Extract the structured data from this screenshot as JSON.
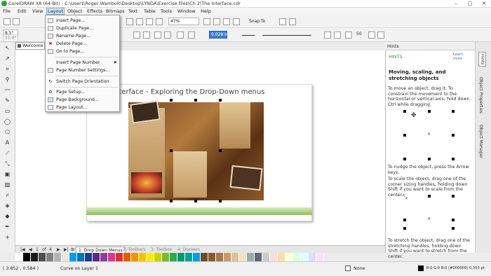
{
  "title": "CorelDRAW X8 (64-Bit) - C:\\Users\\Roger Wambolt\\Desktop\\LYNDA\\Exercise files\\Ch 2\\The Interface.cdr",
  "menubar": [
    "File",
    "Edit",
    "View",
    "Layout",
    "Object",
    "Effects",
    "Bitmaps",
    "Text",
    "Table",
    "Tools",
    "Window",
    "Help"
  ],
  "toolbar": {
    "zoom": "47%",
    "snap": "Snap To",
    "width_field": "8.5\"",
    "height_field": "11.0\"",
    "x_field": "0.028 in",
    "size_num": "50"
  },
  "doc_tab": "Welcome Sc...",
  "layout_menu": [
    {
      "label": "Insert Page...",
      "icon": "insert-page-icon"
    },
    {
      "label": "Duplicate Page...",
      "icon": "duplicate-page-icon"
    },
    {
      "label": "Rename Page...",
      "icon": "rename-page-icon"
    },
    {
      "label": "Delete Page...",
      "icon": "delete-page-icon"
    },
    {
      "label": "Go to Page...",
      "icon": "go-to-page-icon"
    },
    {
      "label": "Insert Page Number",
      "icon": ""
    },
    {
      "label": "Page Number Settings...",
      "icon": "page-number-settings-icon"
    },
    {
      "label": "Switch Page Orientation",
      "icon": "switch-orientation-icon"
    },
    {
      "label": "Page Setup...",
      "icon": "page-setup-icon"
    },
    {
      "label": "Page Background...",
      "icon": "page-background-icon"
    },
    {
      "label": "Page Layout...",
      "icon": "page-layout-icon"
    }
  ],
  "canvas": {
    "page_title": "Interface - Exploring the Drop-Down menus"
  },
  "hints": {
    "panel_title": "Hints",
    "header": "HINTS",
    "learn_more": "Learn more",
    "heading": "Moving, scaling, and stretching objects",
    "p1": "To move an object, drag it. To constrain the movement to the horizontal or vertical axis, hold down Ctrl while dragging.",
    "p2": "To nudge the object, press the Arrow keys.",
    "p3": "To scale the object, drag one of the corner sizing handles, holding down Shift if you want to scale from the center.",
    "p4": "To stretch the object, drag one of the stretching handles, holding down Shift if you want to stretch from the center."
  },
  "docker_tabs": [
    "Hints",
    "Object Properties",
    "Object Manager"
  ],
  "page_nav": {
    "counter": "1",
    "of": "of",
    "total": "4"
  },
  "page_tabs": [
    "1: Drop Down Menus",
    "2: Toolbars",
    "3: Toolbox",
    "4: Dockers"
  ],
  "status": {
    "coords": "( 3.852 , 0.584 )",
    "object": "Curve on Layer 1",
    "fill": "None",
    "color_info": "R:0 G:0 B:0 (#000000) 0.353 pt"
  },
  "palette": [
    "#ffffff",
    "#000000",
    "#1a1a1a",
    "#4d4d4d",
    "#808080",
    "#b3b3b3",
    "#e6e6e6",
    "#00a0e3",
    "#0073bf",
    "#1d3b8f",
    "#5b2c86",
    "#8e3d98",
    "#d63a8f",
    "#e62e2e",
    "#e65c00",
    "#f39200",
    "#f9c000",
    "#ffed00",
    "#c8d400",
    "#7ab929",
    "#2fa84f",
    "#009a6e",
    "#00a19a",
    "#009ee0",
    "#6b4c2a",
    "#8b5a2b",
    "#a9764a",
    "#c69c6d",
    "#e0c19a",
    "#f4e0c1",
    "#9aa",
    "#667",
    "#ccc",
    "#fdd",
    "#fda",
    "#ffd",
    "#dfd",
    "#dff",
    "#ddf",
    "#fdf"
  ]
}
